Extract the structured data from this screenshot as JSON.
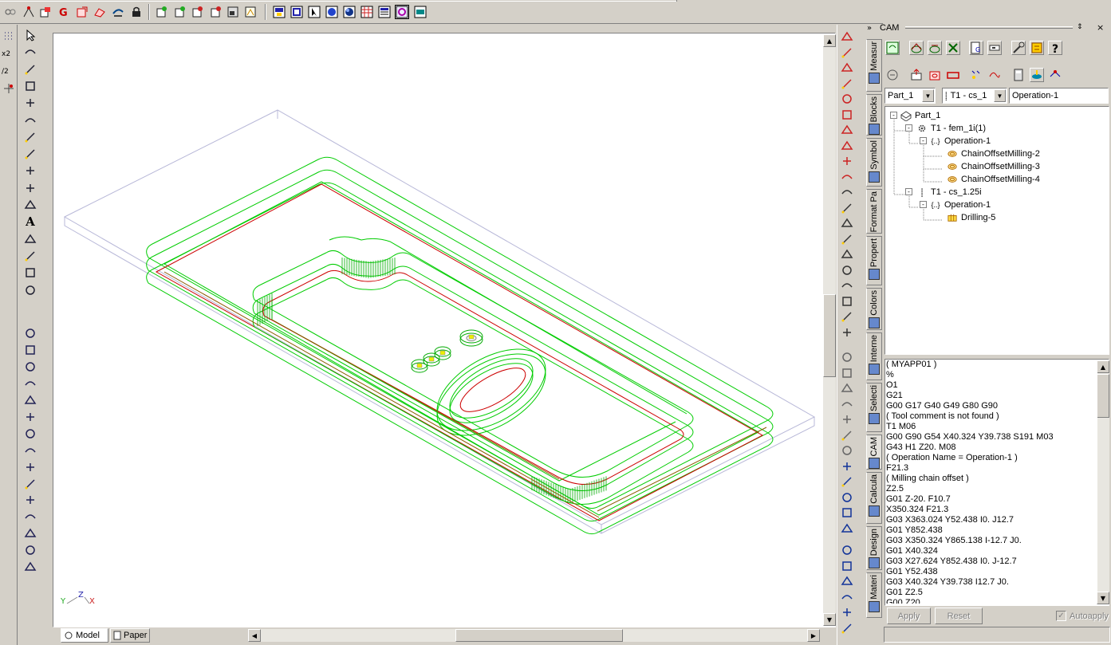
{
  "top_toolbar": {
    "left_icons": [
      "layers-icon",
      "snap-icon",
      "new-part-icon",
      "g-code-icon",
      "export-icon",
      "sketch-icon",
      "refresh-icon",
      "lock-icon"
    ],
    "mid_icons": [
      "insert-1-icon",
      "insert-2-icon",
      "insert-3-icon",
      "insert-4-icon",
      "insert-5-icon",
      "insert-6-icon"
    ],
    "right_icons": [
      "view-front-icon",
      "view-top-icon",
      "select-icon",
      "render-icon",
      "shade-icon",
      "grid-icon",
      "table-icon",
      "cam-view-icon",
      "layer-view-icon"
    ]
  },
  "left_toolbar": {
    "narrow_labels": [
      "x2",
      "/2"
    ],
    "tools": [
      "select-arrow-icon",
      "point-icon",
      "line-icon",
      "polyline-icon",
      "dash-line-icon",
      "circle-icon",
      "circle-center-icon",
      "arc-icon",
      "fill-icon",
      "color-fill-icon",
      "move-icon",
      "text-icon",
      "corner-icon",
      "fillet-icon",
      "dimension-icon",
      "copy-icon",
      "box-icon",
      "cylinder-icon",
      "sphere-icon",
      "wedge-icon",
      "extrude-icon",
      "revolve-icon",
      "loft-icon",
      "sweep-icon",
      "torus-icon",
      "bore-icon",
      "mesh-icon",
      "shell-icon",
      "cone-icon",
      "axes-3d-icon",
      "surface-icon"
    ]
  },
  "viewport": {
    "axis_labels": {
      "y": "Y",
      "z": "Z",
      "x": "X"
    },
    "stock_color": "#b8b8d8",
    "path_green": "#00cc00",
    "path_red": "#cc0000"
  },
  "bottom_tabs": {
    "model": "Model",
    "paper": "Paper"
  },
  "right_toolstrip": [
    "snap-grid-icon",
    "dist-icon",
    "endpoint-icon",
    "midpoint-icon",
    "center-icon",
    "quadrant-icon",
    "intersection-icon",
    "perp-icon",
    "tangent-icon",
    "near-icon",
    "grid-dot-icon",
    "orbit-icon",
    "pan-icon",
    "zoom-window-icon",
    "zoom-all-icon",
    "zoom-in-icon",
    "zoom-out-icon",
    "magnet-icon",
    "measure-icon",
    "angle-icon",
    "shade-1-icon",
    "shade-2-icon",
    "shade-3-icon",
    "shade-4-icon",
    "shade-5-icon",
    "shade-6-icon",
    "shade-7-icon",
    "pen-1-icon",
    "pen-2-icon",
    "pen-3-icon",
    "pen-4-icon",
    "pen-5-icon",
    "nav-1-icon",
    "nav-2-icon",
    "nav-3-icon",
    "nav-4-icon",
    "nav-5-icon",
    "nav-6-icon"
  ],
  "side_tabs": [
    "Measur",
    "Blocks",
    "Symbol",
    "Format Pa",
    "Propert",
    "Colors",
    "Interne",
    "Selecti",
    "CAM",
    "Calcula",
    "Design",
    "Materi"
  ],
  "cam_panel": {
    "title": "CAM",
    "part_combo": "Part_1",
    "tool_combo": "T1 - cs_1",
    "operation_field": "Operation-1",
    "tree": [
      {
        "label": "Part_1",
        "level": 0
      },
      {
        "label": "T1 - fem_1i(1)",
        "level": 1
      },
      {
        "label": "Operation-1",
        "level": 2
      },
      {
        "label": "ChainOffsetMilling-2",
        "level": 3
      },
      {
        "label": "ChainOffsetMilling-3",
        "level": 3
      },
      {
        "label": "ChainOffsetMilling-4",
        "level": 3
      },
      {
        "label": "T1 - cs_1.25i",
        "level": 1
      },
      {
        "label": "Operation-1",
        "level": 2
      },
      {
        "label": "Drilling-5",
        "level": 3
      }
    ],
    "gcode": [
      "( MYAPP01 )",
      "%",
      "O1",
      "G21",
      "G00 G17 G40 G49 G80 G90",
      "( Tool comment is not found )",
      "T1 M06",
      "G00 G90 G54 X40.324 Y39.738 S191 M03",
      "G43 H1 Z20. M08",
      "( Operation Name = Operation-1 )",
      "F21.3",
      "( Milling chain offset )",
      "Z2.5",
      "G01 Z-20. F10.7",
      "X350.324 F21.3",
      "G03 X363.024 Y52.438 I0. J12.7",
      "G01 Y852.438",
      "G03 X350.324 Y865.138 I-12.7 J0.",
      "G01 X40.324",
      "G03 X27.624 Y852.438 I0. J-12.7",
      "G01 Y52.438",
      "G03 X40.324 Y39.738 I12.7 J0.",
      "G01 Z2.5",
      "G00 Z20"
    ],
    "apply": "Apply",
    "reset": "Reset",
    "autoapply": "Autoapply"
  }
}
